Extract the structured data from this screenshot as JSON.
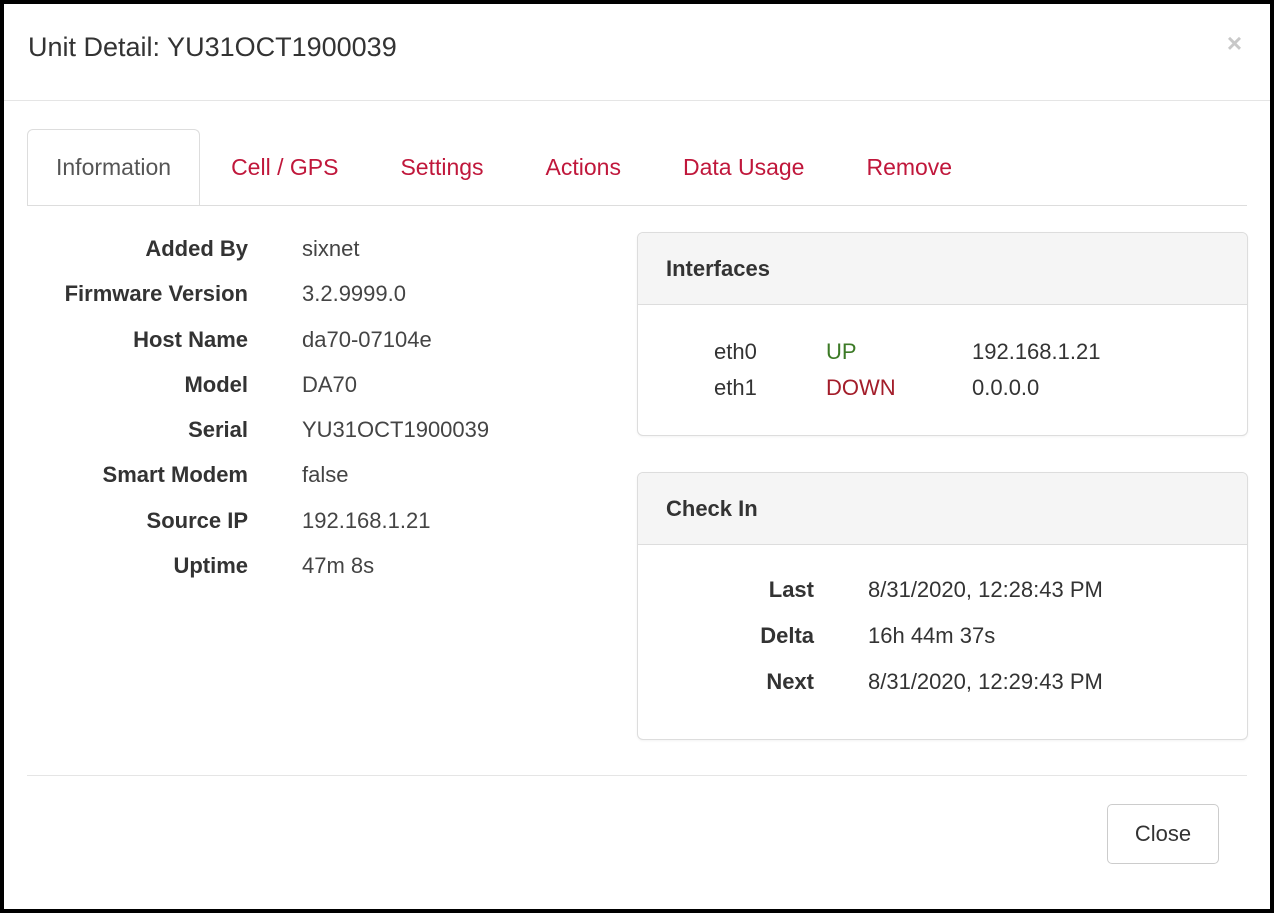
{
  "modal": {
    "title": "Unit Detail: YU31OCT1900039",
    "close_symbol": "×"
  },
  "tabs": [
    {
      "label": "Information",
      "active": true
    },
    {
      "label": "Cell / GPS",
      "active": false
    },
    {
      "label": "Settings",
      "active": false
    },
    {
      "label": "Actions",
      "active": false
    },
    {
      "label": "Data Usage",
      "active": false
    },
    {
      "label": "Remove",
      "active": false
    }
  ],
  "info": [
    {
      "label": "Added By",
      "value": "sixnet"
    },
    {
      "label": "Firmware Version",
      "value": "3.2.9999.0"
    },
    {
      "label": "Host Name",
      "value": "da70-07104e"
    },
    {
      "label": "Model",
      "value": "DA70"
    },
    {
      "label": "Serial",
      "value": "YU31OCT1900039"
    },
    {
      "label": "Smart Modem",
      "value": "false"
    },
    {
      "label": "Source IP",
      "value": "192.168.1.21"
    },
    {
      "label": "Uptime",
      "value": "47m 8s"
    }
  ],
  "interfaces": {
    "title": "Interfaces",
    "rows": [
      {
        "name": "eth0",
        "status": "UP",
        "ip": "192.168.1.21"
      },
      {
        "name": "eth1",
        "status": "DOWN",
        "ip": "0.0.0.0"
      }
    ]
  },
  "checkin": {
    "title": "Check In",
    "rows": [
      {
        "label": "Last",
        "value": "8/31/2020, 12:28:43 PM"
      },
      {
        "label": "Delta",
        "value": "16h 44m 37s"
      },
      {
        "label": "Next",
        "value": "8/31/2020, 12:29:43 PM"
      }
    ]
  },
  "footer": {
    "close_label": "Close"
  },
  "colors": {
    "tab_link": "#c0173b",
    "status_up": "#3c7a26",
    "status_down": "#a31d2a"
  }
}
